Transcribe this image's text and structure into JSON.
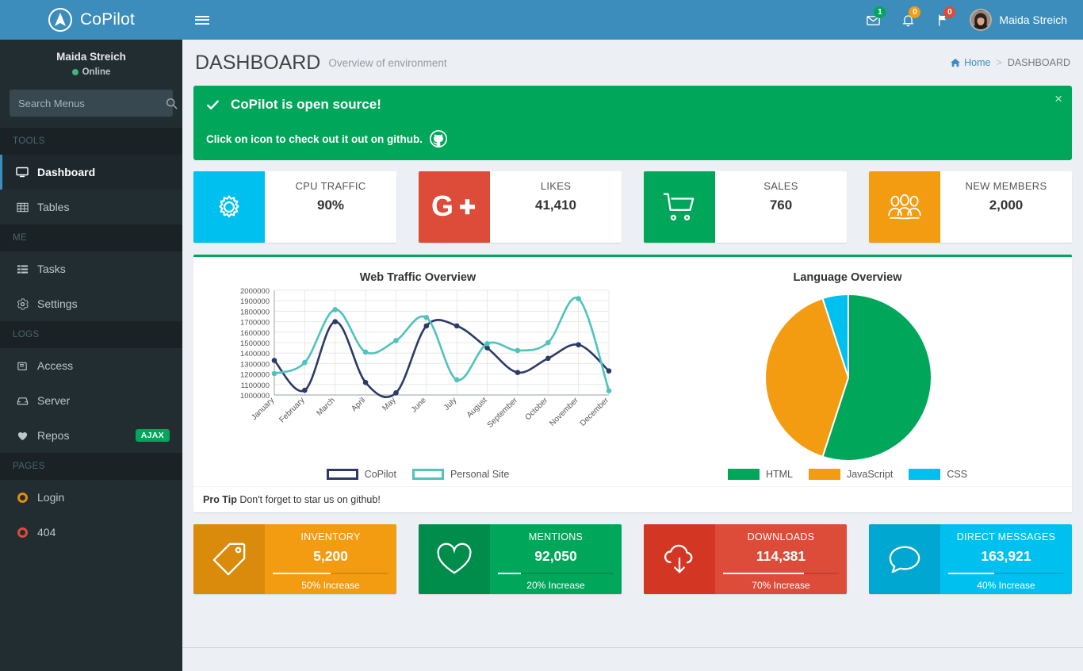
{
  "brand": {
    "name": "CoPilot"
  },
  "sidebar": {
    "user": {
      "name": "Maida Streich",
      "status": "Online"
    },
    "search": {
      "placeholder": "Search Menus",
      "value": "",
      "icon": "search-icon"
    },
    "sections": [
      {
        "header": "TOOLS",
        "items": [
          {
            "label": "Dashboard",
            "icon": "desktop-icon",
            "active": true,
            "badge": ""
          },
          {
            "label": "Tables",
            "icon": "table-icon",
            "active": false,
            "badge": ""
          }
        ]
      },
      {
        "header": "ME",
        "items": [
          {
            "label": "Tasks",
            "icon": "list-icon",
            "active": false,
            "badge": ""
          },
          {
            "label": "Settings",
            "icon": "gear-icon",
            "active": false,
            "badge": ""
          }
        ]
      },
      {
        "header": "LOGS",
        "items": [
          {
            "label": "Access",
            "icon": "book-icon",
            "active": false,
            "badge": ""
          },
          {
            "label": "Server",
            "icon": "inbox-icon",
            "active": false,
            "badge": ""
          },
          {
            "label": "Repos",
            "icon": "heart-icon",
            "active": false,
            "badge": "AJAX"
          }
        ]
      },
      {
        "header": "PAGES",
        "items": [
          {
            "label": "Login",
            "icon": "circle-o-icon",
            "active": false,
            "badge": "",
            "color": "#e08e0b"
          },
          {
            "label": "404",
            "icon": "circle-o-icon",
            "active": false,
            "badge": "",
            "color": "#dd4b39"
          }
        ]
      }
    ]
  },
  "navbar": {
    "menu_toggle": "hamburger-icon",
    "icons": [
      {
        "name": "envelope-icon",
        "badge": "1",
        "badge_color": "#00a65a"
      },
      {
        "name": "bell-icon",
        "badge": "0",
        "badge_color": "#f39c12"
      },
      {
        "name": "flag-icon",
        "badge": "0",
        "badge_color": "#dd4b39"
      }
    ],
    "user_name": "Maida Streich"
  },
  "header": {
    "title": "DASHBOARD",
    "subtitle": "Overview of environment",
    "breadcrumb": {
      "home": "Home",
      "separator": ">",
      "current": "DASHBOARD"
    }
  },
  "callout": {
    "title": "CoPilot is open source!",
    "body": "Click on icon to check out it out on github.",
    "check_icon": "check-icon",
    "github_icon": "github-icon",
    "close": "×",
    "color": "#00a65a"
  },
  "info_boxes": [
    {
      "text": "CPU TRAFFIC",
      "number": "90%",
      "icon": "gear-icon",
      "color": "#00c0ef"
    },
    {
      "text": "LIKES",
      "number": "41,410",
      "icon": "google-plus-icon",
      "color": "#dd4b39"
    },
    {
      "text": "SALES",
      "number": "760",
      "icon": "shopping-cart-icon",
      "color": "#00a65a"
    },
    {
      "text": "NEW MEMBERS",
      "number": "2,000",
      "icon": "users-icon",
      "color": "#f39c12"
    }
  ],
  "box_footer": {
    "label": "Pro Tip",
    "text": " Don't forget to star us on github!"
  },
  "small_boxes": [
    {
      "text": "INVENTORY",
      "number": "5,200",
      "desc": "50% Increase",
      "progress": 50,
      "icon": "tag-icon",
      "color": "#f39c12",
      "icon_color": "#db8b0b"
    },
    {
      "text": "MENTIONS",
      "number": "92,050",
      "desc": "20% Increase",
      "progress": 20,
      "icon": "heart-icon",
      "color": "#00a65a",
      "icon_color": "#008d4c"
    },
    {
      "text": "DOWNLOADS",
      "number": "114,381",
      "desc": "70% Increase",
      "progress": 70,
      "icon": "cloud-download-icon",
      "color": "#dd4b39",
      "icon_color": "#d33724"
    },
    {
      "text": "DIRECT MESSAGES",
      "number": "163,921",
      "desc": "40% Increase",
      "progress": 40,
      "icon": "comment-icon",
      "color": "#00c0ef",
      "icon_color": "#00a7d0"
    }
  ],
  "chart_data": [
    {
      "type": "line",
      "title": "Web Traffic Overview",
      "xlabel": "",
      "ylabel": "",
      "ylim": [
        1000000,
        2000000
      ],
      "yticks": [
        1000000,
        1100000,
        1200000,
        1300000,
        1400000,
        1500000,
        1600000,
        1700000,
        1800000,
        1900000,
        2000000
      ],
      "ytick_labels": [
        "1000000",
        "1100000",
        "1200000",
        "1300000",
        "1400000",
        "1500000",
        "1600000",
        "1700000",
        "1800000",
        "1900000",
        "2000000"
      ],
      "categories": [
        "January",
        "February",
        "March",
        "April",
        "May",
        "June",
        "July",
        "August",
        "September",
        "October",
        "November",
        "December"
      ],
      "grid": true,
      "legend_position": "bottom",
      "series": [
        {
          "name": "CoPilot",
          "color": "#2b3a67",
          "values": [
            1330000,
            1045000,
            1700000,
            1120000,
            1020000,
            1660000,
            1660000,
            1450000,
            1215000,
            1350000,
            1480000,
            1230000
          ]
        },
        {
          "name": "Personal Site",
          "color": "#4fc3bd",
          "values": [
            1205000,
            1310000,
            1815000,
            1410000,
            1520000,
            1740000,
            1145000,
            1490000,
            1425000,
            1500000,
            1920000,
            1040000
          ]
        }
      ]
    },
    {
      "type": "pie",
      "title": "Language Overview",
      "grid": false,
      "legend_position": "bottom",
      "labels": [
        "HTML",
        "JavaScript",
        "CSS"
      ],
      "values": [
        55,
        40,
        5
      ],
      "colors": [
        "#00a65a",
        "#f39c12",
        "#00c0ef"
      ]
    }
  ]
}
